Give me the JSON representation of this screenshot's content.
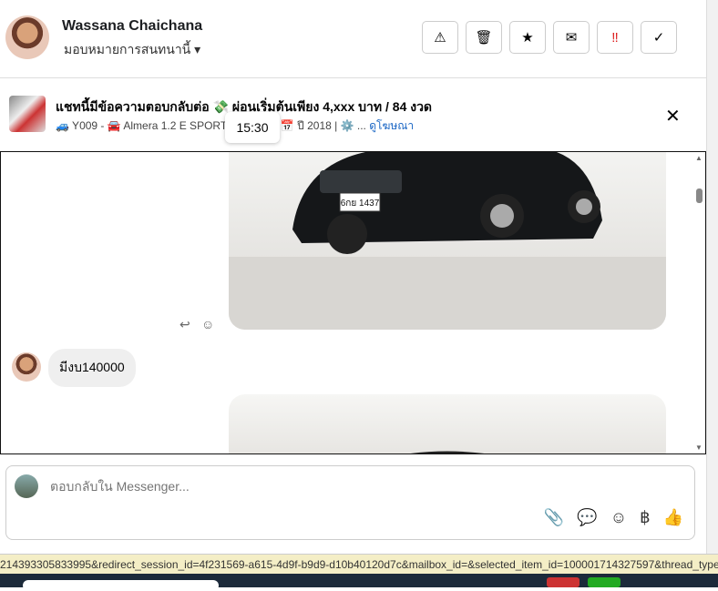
{
  "header": {
    "name": "Wassana Chaichana",
    "assign_label": "มอบหมายการสนทนานี้"
  },
  "actions": [
    {
      "id": "spam",
      "icon": "⚠"
    },
    {
      "id": "delete",
      "icon": "🗑"
    },
    {
      "id": "star",
      "icon": "★"
    },
    {
      "id": "mail",
      "icon": "✉"
    },
    {
      "id": "important",
      "icon": "‼"
    },
    {
      "id": "done",
      "icon": "✓"
    }
  ],
  "banner": {
    "title": "แชทนี้มีข้อความตอบกลับต่อ 💸 ผ่อนเริ่มต้นเพียง 4,xxx บาท / 84 งวด",
    "subtitle": "🚙 Y009 - 🚘 Almera 1.2 E SPORTECH 2018 📅 ปี 2018 | ⚙️ ...",
    "link": "ดูโฆษณา",
    "tooltip": "15:30"
  },
  "image1": {
    "plate": "6กย 1437"
  },
  "messages": [
    {
      "text": "มีงบ140000"
    }
  ],
  "composer": {
    "placeholder": "ตอบกลับใน Messenger...",
    "tools": [
      "📎",
      "💬",
      "☺",
      "฿",
      "👍"
    ]
  },
  "status_url": "214393305833995&redirect_session_id=4f231569-a615-4d9f-b9d9-d10b40120d7c&mailbox_id=&selected_item_id=100001714327597&thread_type="
}
